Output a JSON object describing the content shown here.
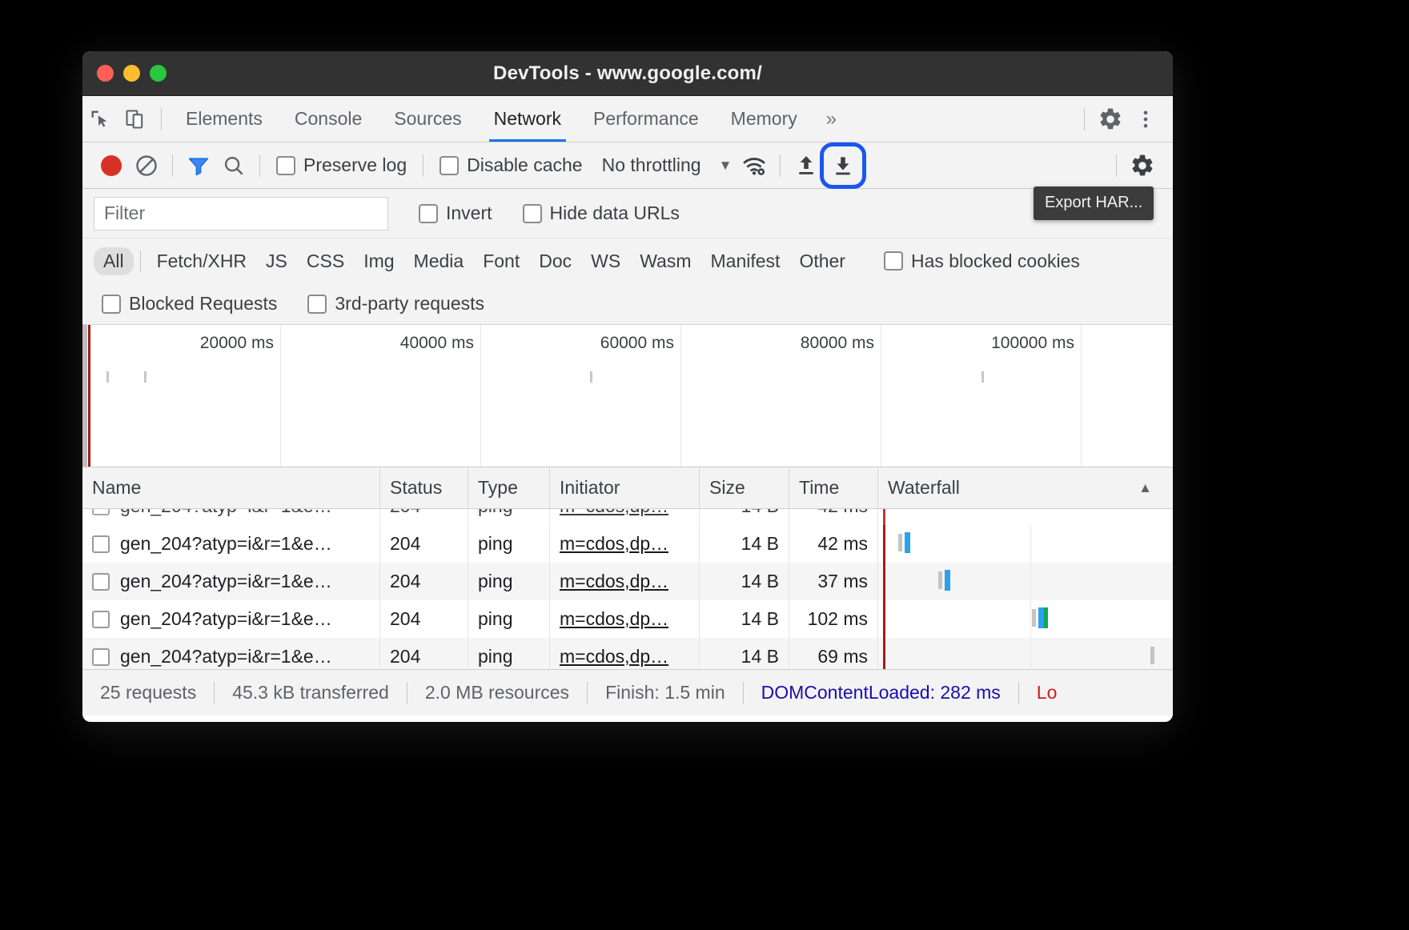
{
  "window": {
    "title": "DevTools - www.google.com/",
    "traffic_lights": [
      "close",
      "minimize",
      "zoom"
    ]
  },
  "tabbar": {
    "inspect_icon": "inspect-cursor-icon",
    "device_icon": "device-toolbar-icon",
    "tabs": [
      {
        "label": "Elements",
        "active": false
      },
      {
        "label": "Console",
        "active": false
      },
      {
        "label": "Sources",
        "active": false
      },
      {
        "label": "Network",
        "active": true
      },
      {
        "label": "Performance",
        "active": false
      },
      {
        "label": "Memory",
        "active": false
      }
    ],
    "more_tabs": "»",
    "settings_icon": "gear-icon",
    "more_icon": "kebab-menu-icon"
  },
  "network_toolbar": {
    "record_label": "record-button",
    "clear_label": "clear-button",
    "filter_icon": "funnel-icon",
    "search_icon": "search-icon",
    "preserve_log": {
      "label": "Preserve log",
      "checked": false
    },
    "disable_cache": {
      "label": "Disable cache",
      "checked": false
    },
    "throttling": {
      "value": "No throttling",
      "caret": "▼"
    },
    "wifi_icon": "network-conditions-icon",
    "import_icon": "import-har-icon",
    "export_icon": "export-har-icon",
    "export_highlighted": true,
    "settings_icon": "gear-icon",
    "tooltip": "Export HAR..."
  },
  "filter_row": {
    "filter_placeholder": "Filter",
    "filter_value": "",
    "invert": {
      "label": "Invert",
      "checked": false
    },
    "hide_data_urls": {
      "label": "Hide data URLs",
      "checked": false
    }
  },
  "type_filters": [
    {
      "label": "All",
      "active": true
    },
    {
      "label": "Fetch/XHR",
      "active": false
    },
    {
      "label": "JS",
      "active": false
    },
    {
      "label": "CSS",
      "active": false
    },
    {
      "label": "Img",
      "active": false
    },
    {
      "label": "Media",
      "active": false
    },
    {
      "label": "Font",
      "active": false
    },
    {
      "label": "Doc",
      "active": false
    },
    {
      "label": "WS",
      "active": false
    },
    {
      "label": "Wasm",
      "active": false
    },
    {
      "label": "Manifest",
      "active": false
    },
    {
      "label": "Other",
      "active": false
    }
  ],
  "extra_filters": {
    "has_blocked_cookies": {
      "label": "Has blocked cookies",
      "checked": false
    },
    "blocked_requests": {
      "label": "Blocked Requests",
      "checked": false
    },
    "third_party_requests": {
      "label": "3rd-party requests",
      "checked": false
    }
  },
  "overview": {
    "ticks": [
      "20000 ms",
      "40000 ms",
      "60000 ms",
      "80000 ms",
      "100000 ms"
    ]
  },
  "table": {
    "columns": [
      "Name",
      "Status",
      "Type",
      "Initiator",
      "Size",
      "Time",
      "Waterfall"
    ],
    "sorted_column": "Waterfall",
    "sort_arrow": "▲",
    "rows": [
      {
        "name": "gen_204?atyp=i&r=1&e…",
        "status": "204",
        "type": "ping",
        "initiator": "m=cdos,dp…",
        "size": "14 B",
        "time": "42 ms"
      },
      {
        "name": "gen_204?atyp=i&r=1&e…",
        "status": "204",
        "type": "ping",
        "initiator": "m=cdos,dp…",
        "size": "14 B",
        "time": "37 ms"
      },
      {
        "name": "gen_204?atyp=i&r=1&e…",
        "status": "204",
        "type": "ping",
        "initiator": "m=cdos,dp…",
        "size": "14 B",
        "time": "102 ms"
      },
      {
        "name": "gen_204?atyp=i&r=1&e…",
        "status": "204",
        "type": "ping",
        "initiator": "m=cdos,dp…",
        "size": "14 B",
        "time": "69 ms"
      }
    ]
  },
  "statusbar": {
    "requests": "25 requests",
    "transferred": "45.3 kB transferred",
    "resources": "2.0 MB resources",
    "finish": "Finish: 1.5 min",
    "dom_content_loaded": "DOMContentLoaded: 282 ms",
    "load": "Lo",
    "dcl_color": "#1a0dab",
    "load_color": "#d01b1b"
  }
}
